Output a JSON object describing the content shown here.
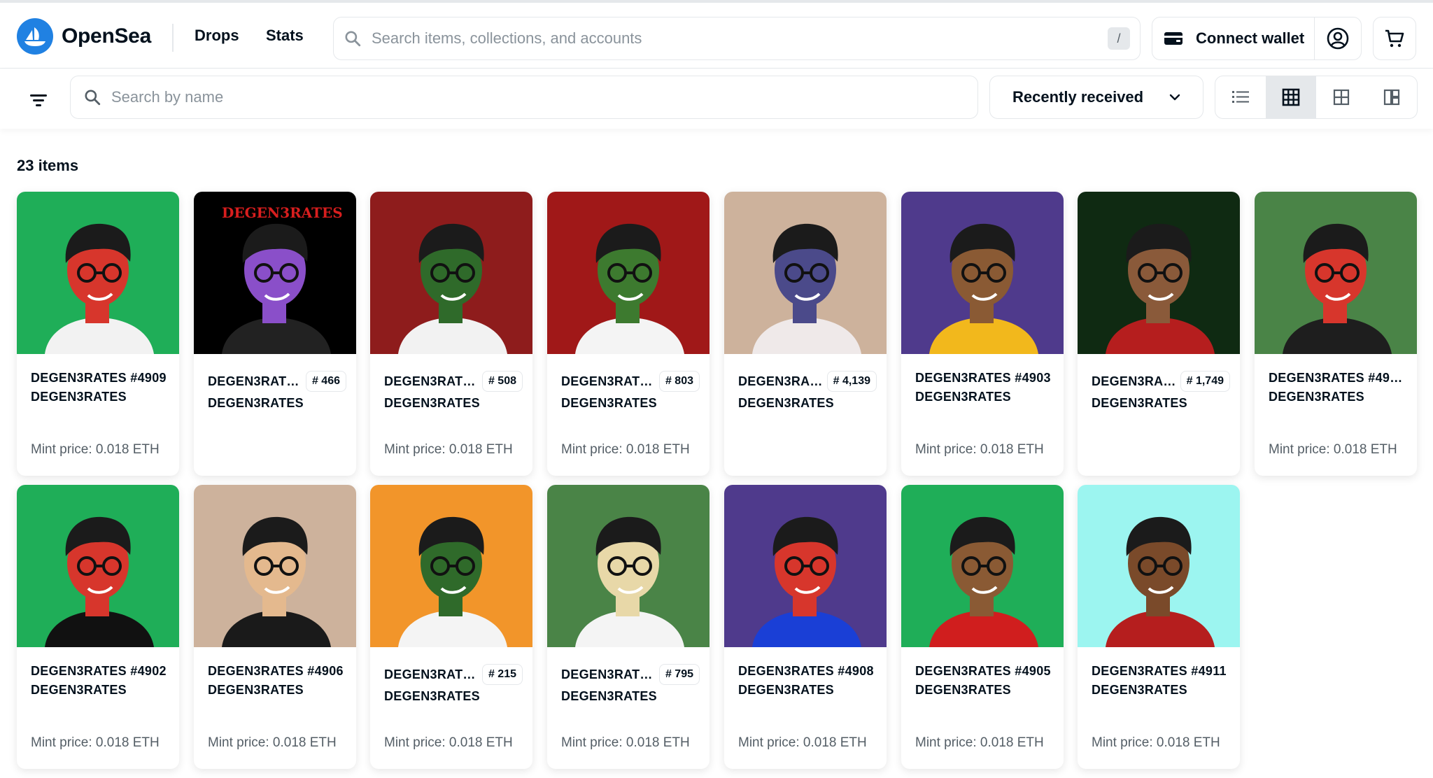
{
  "header": {
    "brand": "OpenSea",
    "nav": [
      "Drops",
      "Stats"
    ],
    "search_placeholder": "Search items, collections, and accounts",
    "search_shortcut": "/",
    "wallet_label": "Connect wallet"
  },
  "toolbar": {
    "search_placeholder": "Search by name",
    "sort_label": "Recently received"
  },
  "items_count": "23 items",
  "colors": {
    "accent": "#2081e2",
    "border": "#e5e8eb",
    "muted": "#545e66"
  },
  "cards": [
    {
      "name": "DEGEN3RATES #4909",
      "badge": "",
      "collection": "DEGEN3RATES",
      "mint": "Mint price: 0.018 ETH",
      "bg": "#1fae58",
      "skin": "#d7362c",
      "shirt": "#f2f2f2"
    },
    {
      "name": "DEGEN3RAT…",
      "badge": "# 466",
      "collection": "DEGEN3RATES",
      "mint": "",
      "watermark": "DEGEN3RATES",
      "bg": "#000000",
      "skin": "#8a4fc9",
      "shirt": "#222222"
    },
    {
      "name": "DEGEN3RAT…",
      "badge": "# 508",
      "collection": "DEGEN3RATES",
      "mint": "Mint price: 0.018 ETH",
      "bg": "#8e1c1c",
      "skin": "#2f6a2a",
      "shirt": "#f2f2f2"
    },
    {
      "name": "DEGEN3RAT…",
      "badge": "# 803",
      "collection": "DEGEN3RATES",
      "mint": "Mint price: 0.018 ETH",
      "bg": "#a01818",
      "skin": "#3d7a2f",
      "shirt": "#f4f4f4"
    },
    {
      "name": "DEGEN3RA…",
      "badge": "# 4,139",
      "collection": "DEGEN3RATES",
      "mint": "",
      "bg": "#cdb29c",
      "skin": "#4b4a8a",
      "shirt": "#efe9e9"
    },
    {
      "name": "DEGEN3RATES #4903",
      "badge": "",
      "collection": "DEGEN3RATES",
      "mint": "Mint price: 0.018 ETH",
      "bg": "#4f3a8c",
      "skin": "#8a5a34",
      "shirt": "#f2b81c"
    },
    {
      "name": "DEGEN3RA…",
      "badge": "# 1,749",
      "collection": "DEGEN3RATES",
      "mint": "",
      "bg": "#0f2a12",
      "skin": "#8a5a3a",
      "shirt": "#b51e1e"
    },
    {
      "name": "DEGEN3RATES #490…",
      "badge": "",
      "collection": "DEGEN3RATES",
      "mint": "Mint price: 0.018 ETH",
      "bg": "#4a8447",
      "skin": "#d7362c",
      "shirt": "#1e1e1e"
    },
    {
      "name": "DEGEN3RATES #4902",
      "badge": "",
      "collection": "DEGEN3RATES",
      "mint": "Mint price: 0.018 ETH",
      "bg": "#1fae58",
      "skin": "#d7362c",
      "shirt": "#111111"
    },
    {
      "name": "DEGEN3RATES #4906",
      "badge": "",
      "collection": "DEGEN3RATES",
      "mint": "Mint price: 0.018 ETH",
      "bg": "#cdb29c",
      "skin": "#e4b98e",
      "shirt": "#1a1a1a"
    },
    {
      "name": "DEGEN3RAT…",
      "badge": "# 215",
      "collection": "DEGEN3RATES",
      "mint": "Mint price: 0.018 ETH",
      "bg": "#f2952a",
      "skin": "#2f6a2a",
      "shirt": "#f4f4f4"
    },
    {
      "name": "DEGEN3RAT…",
      "badge": "# 795",
      "collection": "DEGEN3RATES",
      "mint": "Mint price: 0.018 ETH",
      "bg": "#4a8447",
      "skin": "#e8d8a8",
      "shirt": "#f4f4f4"
    },
    {
      "name": "DEGEN3RATES #4908",
      "badge": "",
      "collection": "DEGEN3RATES",
      "mint": "Mint price: 0.018 ETH",
      "bg": "#4f3a8c",
      "skin": "#d7362c",
      "shirt": "#1a3fd6"
    },
    {
      "name": "DEGEN3RATES #4905",
      "badge": "",
      "collection": "DEGEN3RATES",
      "mint": "Mint price: 0.018 ETH",
      "bg": "#1fae58",
      "skin": "#8a5a34",
      "shirt": "#d01e1e"
    },
    {
      "name": "DEGEN3RATES #4911",
      "badge": "",
      "collection": "DEGEN3RATES",
      "mint": "Mint price: 0.018 ETH",
      "bg": "#9cf5f0",
      "skin": "#7a4a2a",
      "shirt": "#b51e1e"
    }
  ]
}
